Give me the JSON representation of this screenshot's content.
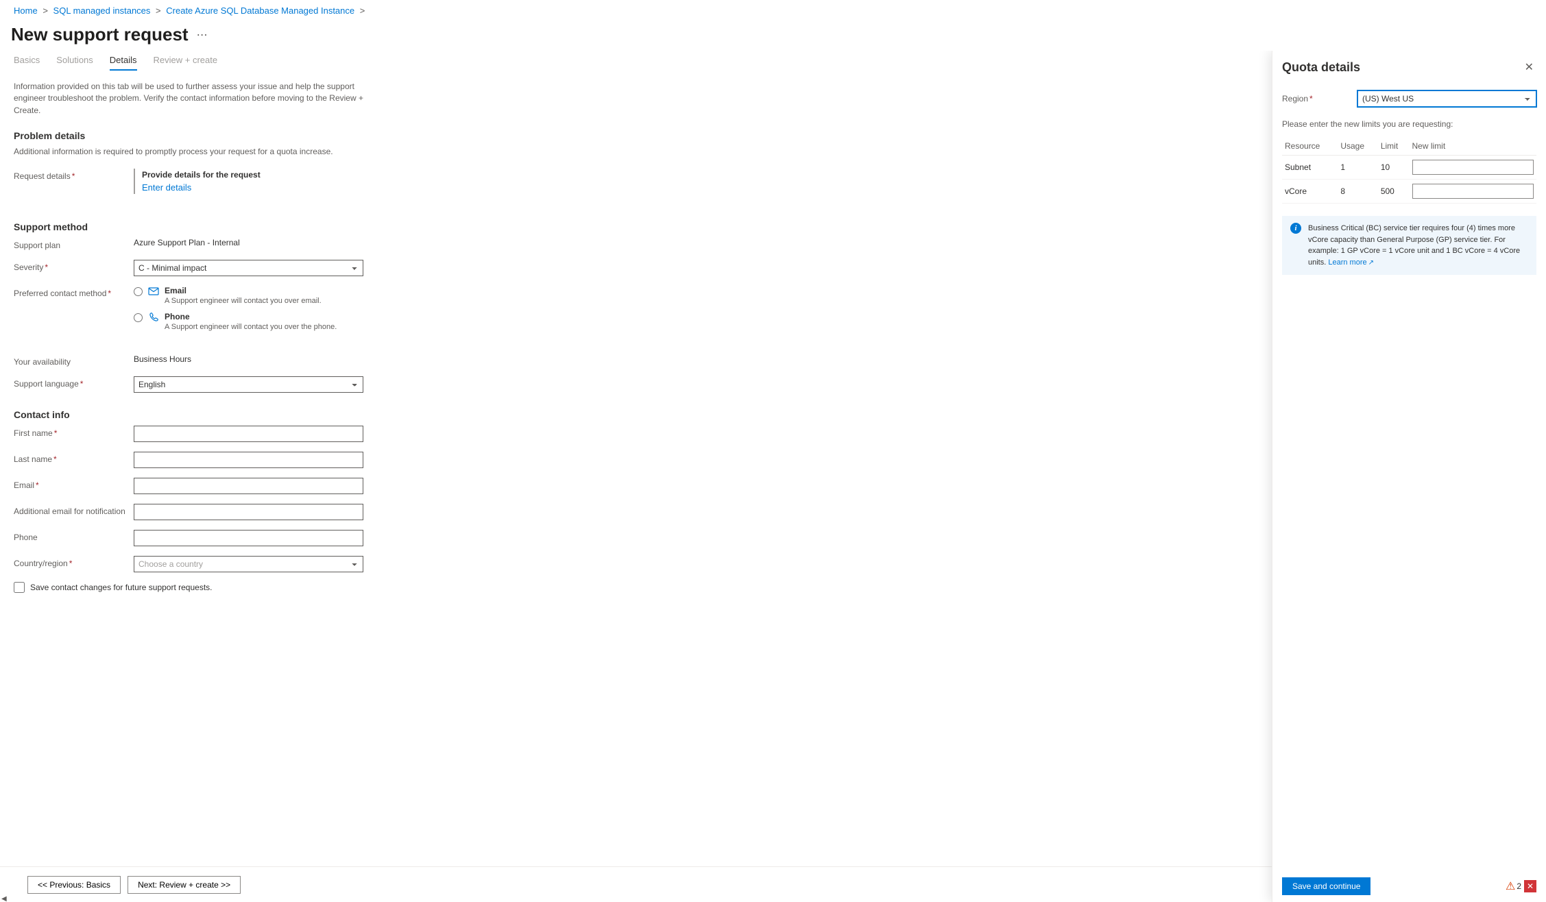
{
  "breadcrumb": [
    {
      "label": "Home"
    },
    {
      "label": "SQL managed instances"
    },
    {
      "label": "Create Azure SQL Database Managed Instance"
    }
  ],
  "page_title": "New support request",
  "tabs": [
    {
      "label": "Basics",
      "active": false
    },
    {
      "label": "Solutions",
      "active": false
    },
    {
      "label": "Details",
      "active": true
    },
    {
      "label": "Review + create",
      "active": false
    }
  ],
  "intro": "Information provided on this tab will be used to further assess your issue and help the support engineer troubleshoot the problem. Verify the contact information before moving to the Review + Create.",
  "problem_details": {
    "heading": "Problem details",
    "sub": "Additional information is required to promptly process your request for a quota increase.",
    "request_details_label": "Request details",
    "provide_title": "Provide details for the request",
    "enter_link": "Enter details"
  },
  "support_method": {
    "heading": "Support method",
    "plan_label": "Support plan",
    "plan_value": "Azure Support Plan - Internal",
    "severity_label": "Severity",
    "severity_value": "C - Minimal impact",
    "contact_label": "Preferred contact method",
    "email_label": "Email",
    "email_desc": "A Support engineer will contact you over email.",
    "phone_label": "Phone",
    "phone_desc": "A Support engineer will contact you over the phone.",
    "availability_label": "Your availability",
    "availability_value": "Business Hours",
    "language_label": "Support language",
    "language_value": "English"
  },
  "contact_info": {
    "heading": "Contact info",
    "first_name": "First name",
    "last_name": "Last name",
    "email": "Email",
    "additional_email": "Additional email for notification",
    "phone": "Phone",
    "country": "Country/region",
    "country_placeholder": "Choose a country",
    "save_checkbox": "Save contact changes for future support requests."
  },
  "footer": {
    "prev": "<< Previous: Basics",
    "next": "Next: Review + create >>"
  },
  "panel": {
    "title": "Quota details",
    "region_label": "Region",
    "region_value": "(US) West US",
    "instruction": "Please enter the new limits you are requesting:",
    "table": {
      "headers": {
        "resource": "Resource",
        "usage": "Usage",
        "limit": "Limit",
        "new_limit": "New limit"
      },
      "rows": [
        {
          "resource": "Subnet",
          "usage": "1",
          "limit": "10"
        },
        {
          "resource": "vCore",
          "usage": "8",
          "limit": "500"
        }
      ]
    },
    "info_text": "Business Critical (BC) service tier requires four (4) times more vCore capacity than General Purpose (GP) service tier. For example: 1 GP vCore = 1 vCore unit and 1 BC vCore = 4 vCore units. ",
    "learn_more": "Learn more",
    "save_btn": "Save and continue",
    "warn_count": "2"
  }
}
